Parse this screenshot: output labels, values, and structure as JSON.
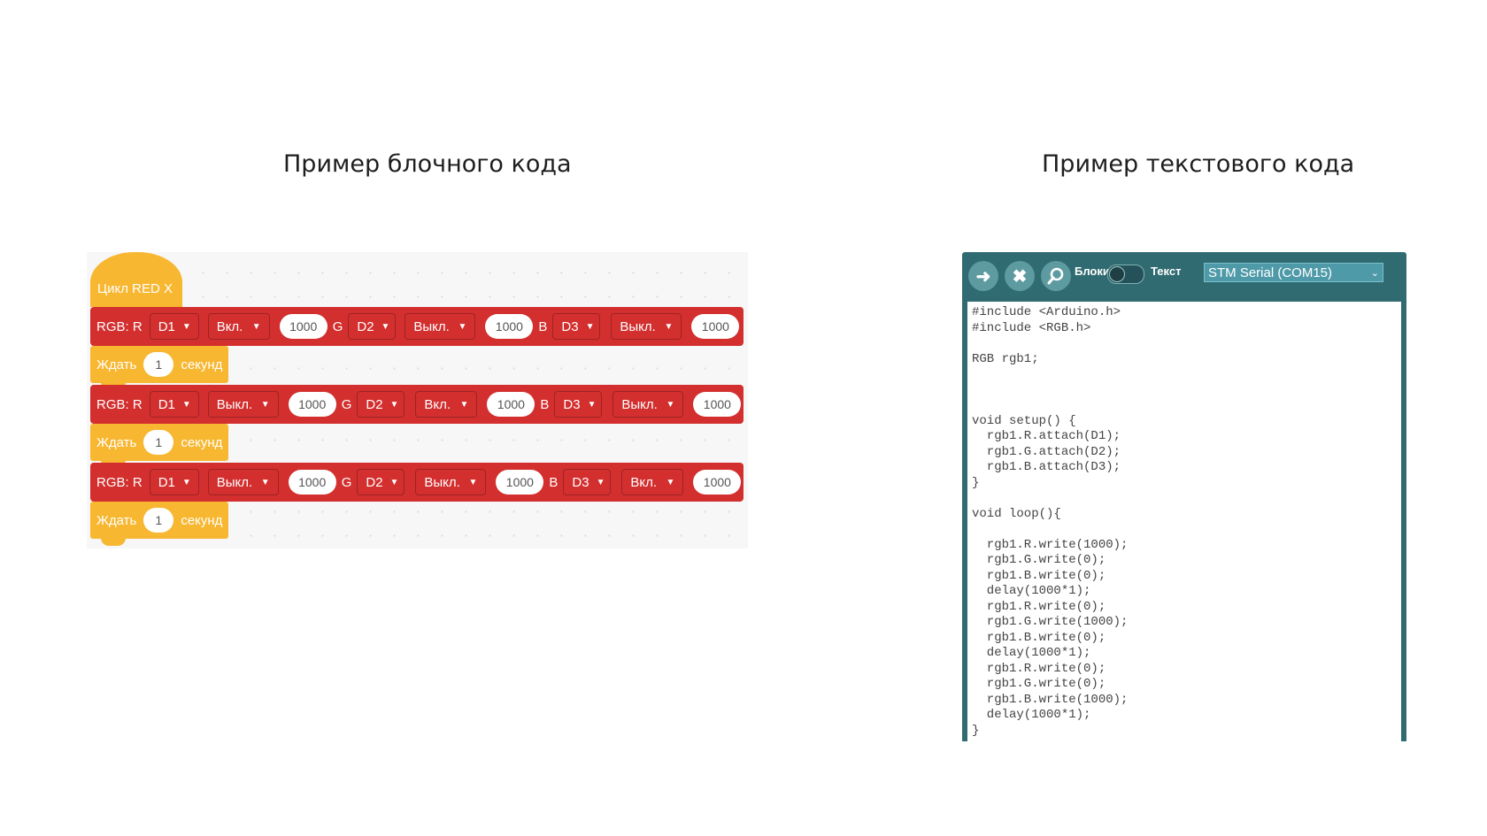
{
  "captions": {
    "left": "Пример блочного кода",
    "right": "Пример текстового кода"
  },
  "blocks": {
    "hat_label": "Цикл RED X",
    "rgb_label": "RGB: R",
    "g_label": "G",
    "b_label": "B",
    "rgb_rows": [
      {
        "r_pin": "D1",
        "r_state": "Вкл.",
        "r_value": "1000",
        "g_pin": "D2",
        "g_state": "Выкл.",
        "g_value": "1000",
        "b_pin": "D3",
        "b_state": "Выкл.",
        "b_value": "1000"
      },
      {
        "r_pin": "D1",
        "r_state": "Выкл.",
        "r_value": "1000",
        "g_pin": "D2",
        "g_state": "Вкл.",
        "g_value": "1000",
        "b_pin": "D3",
        "b_state": "Выкл.",
        "b_value": "1000"
      },
      {
        "r_pin": "D1",
        "r_state": "Выкл.",
        "r_value": "1000",
        "g_pin": "D2",
        "g_state": "Выкл.",
        "g_value": "1000",
        "b_pin": "D3",
        "b_state": "Вкл.",
        "b_value": "1000"
      }
    ],
    "wait": {
      "label": "Ждать",
      "value": "1",
      "unit": "секунд"
    }
  },
  "editor": {
    "toggle_left": "Блоки",
    "toggle_right": "Текст",
    "port": "STM Serial (COM15)",
    "icons": {
      "upload": "arrow-right-icon",
      "stop": "close-icon",
      "search": "search-icon"
    },
    "code": "#include <Arduino.h>\n#include <RGB.h>\n\nRGB rgb1;\n\n\n\nvoid setup() {\n  rgb1.R.attach(D1);\n  rgb1.G.attach(D2);\n  rgb1.B.attach(D3);\n}\n\nvoid loop(){\n\n  rgb1.R.write(1000);\n  rgb1.G.write(0);\n  rgb1.B.write(0);\n  delay(1000*1);\n  rgb1.R.write(0);\n  rgb1.G.write(1000);\n  rgb1.B.write(0);\n  delay(1000*1);\n  rgb1.R.write(0);\n  rgb1.G.write(0);\n  rgb1.B.write(1000);\n  delay(1000*1);\n}"
  },
  "colors": {
    "rgb_block": "#d32f2f",
    "wait_block": "#f7b731",
    "editor_frame": "#2f6b70"
  }
}
